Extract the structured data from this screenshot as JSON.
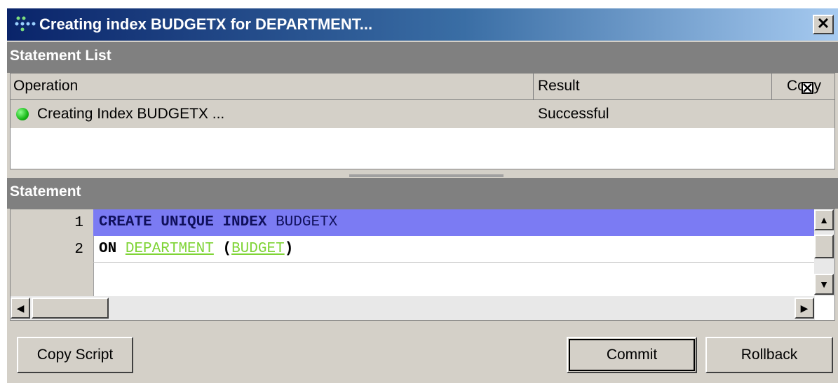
{
  "window": {
    "title": "Creating index BUDGETX for DEPARTMENT...",
    "close_glyph": "✕"
  },
  "statement_list": {
    "heading": "Statement List",
    "columns": [
      "Operation",
      "Result",
      "Copy"
    ],
    "rows": [
      {
        "operation": "Creating Index BUDGETX ...",
        "result": "Successful",
        "copy_checked": true,
        "status_icon": "green-dot-icon"
      }
    ]
  },
  "statement": {
    "heading": "Statement",
    "line_numbers": [
      "1",
      "2"
    ],
    "lines": [
      {
        "tokens": [
          "CREATE UNIQUE INDEX",
          "BUDGETX"
        ]
      },
      {
        "tokens": [
          "ON",
          "DEPARTMENT",
          "(",
          "BUDGET",
          ")"
        ]
      }
    ]
  },
  "buttons": {
    "copy_script": "Copy Script",
    "commit": "Commit",
    "rollback": "Rollback"
  },
  "colors": {
    "title_bar": "#0a246a",
    "highlight_line": "#7b7bf3",
    "identifier_link": "#7fd436",
    "status_ok": "#17b817"
  }
}
